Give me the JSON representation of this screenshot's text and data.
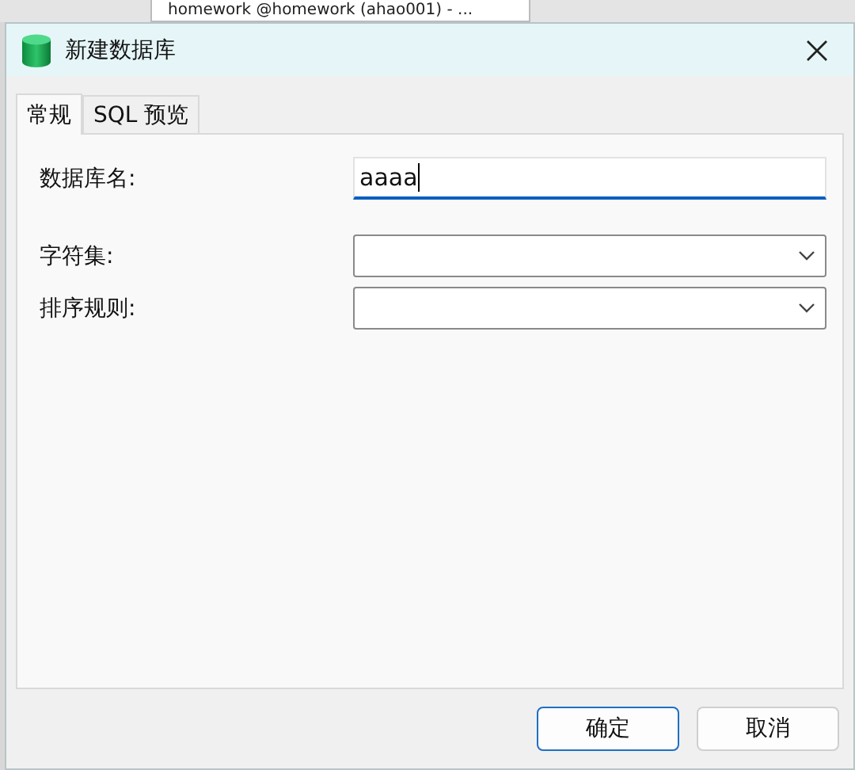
{
  "background_tab": {
    "title": "homework @homework (ahao001) - ..."
  },
  "window": {
    "title": "新建数据库"
  },
  "tabs": [
    {
      "label": "常规",
      "selected": true
    },
    {
      "label": "SQL 预览",
      "selected": false
    }
  ],
  "fields": [
    {
      "kind": "text",
      "label": "数据库名:",
      "value": "aaaa",
      "focused": true
    },
    {
      "kind": "combo",
      "label": "字符集:"
    },
    {
      "kind": "combo",
      "label": "排序规则:"
    }
  ],
  "buttons": [
    {
      "label": "确定",
      "default": true
    },
    {
      "label": "取消",
      "default": false
    }
  ]
}
